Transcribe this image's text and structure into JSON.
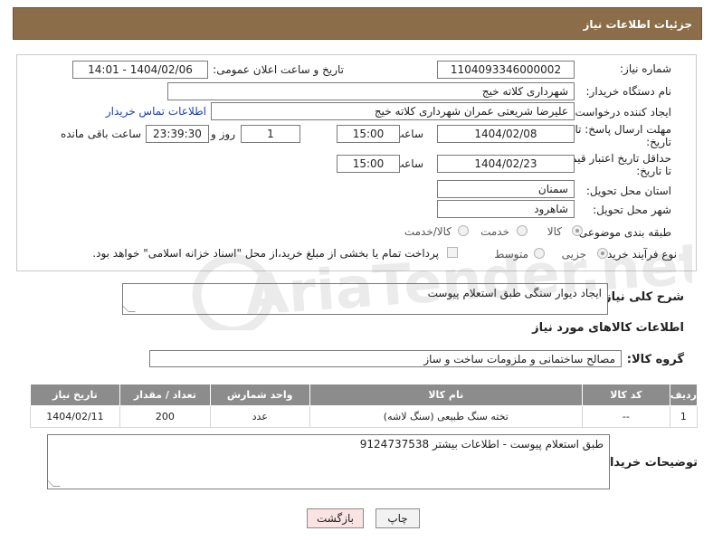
{
  "header": {
    "title": "جزئیات اطلاعات نیاز"
  },
  "form": {
    "need_number_label": "شماره نیاز:",
    "need_number": "1104093346000002",
    "announce_label": "تاریخ و ساعت اعلان عمومی:",
    "announce_value": "1404/02/06 - 14:01",
    "buyer_org_label": "نام دستگاه خریدار:",
    "buyer_org": "شهرداری کلاته خیج",
    "creator_label": "ایجاد کننده درخواست:",
    "creator": "علیرضا شریعتی عمران شهرداری کلاته خیج",
    "contact_link": "اطلاعات تماس خریدار",
    "deadline_label_1": "مهلت ارسال پاسخ: تا",
    "deadline_label_2": "تاریخ:",
    "deadline_date": "1404/02/08",
    "time_label": "ساعت",
    "deadline_time": "15:00",
    "days": "1",
    "days_label": "روز و",
    "remaining_time": "23:39:30",
    "remaining_label": "ساعت باقی مانده",
    "validity_label_1": "حداقل تاریخ اعتبار قیمت:",
    "validity_label_2": "تا تاریخ:",
    "validity_date": "1404/02/23",
    "validity_time": "15:00",
    "province_label": "استان محل تحویل:",
    "province": "سمنان",
    "city_label": "شهر محل تحویل:",
    "city": "شاهرود",
    "category_label": "طبقه بندی موضوعی:",
    "category_options": [
      "کالا",
      "خدمت",
      "کالا/خدمت"
    ],
    "purchase_type_label": "نوع فرآیند خرید :",
    "purchase_options": [
      "جزیی",
      "متوسط"
    ],
    "payment_note": "پرداخت تمام یا بخشی از مبلغ خرید،از محل \"اسناد خزانه اسلامی\" خواهد بود."
  },
  "description": {
    "label": "شرح کلی نیاز:",
    "value": "ایجاد دیوار سنگی طبق استعلام پیوست"
  },
  "goods_section": {
    "title": "اطلاعات کالاهای مورد نیاز",
    "group_label": "گروه کالا:",
    "group_value": "مصالح ساختمانی و ملزومات ساخت و ساز"
  },
  "table": {
    "headers": [
      "ردیف",
      "کد کالا",
      "نام کالا",
      "واحد شمارش",
      "تعداد / مقدار",
      "تاریخ نیاز"
    ],
    "rows": [
      [
        "1",
        "--",
        "تخته سنگ طبیعی (سنگ لاشه)",
        "عدد",
        "200",
        "1404/02/11"
      ]
    ]
  },
  "buyer_notes": {
    "label": "توضیحات خریدار:",
    "value": "طبق استعلام پیوست - اطلاعات بیشتر 9124737538"
  },
  "buttons": {
    "print": "چاپ",
    "back": "بازگشت"
  },
  "watermark": {
    "text": "AriaTender.net"
  },
  "colors": {
    "header_bg": "#8c6d4a",
    "table_header_bg": "#8c8c8c",
    "link": "#1a3fb8",
    "back_button_bg": "#fbe3e3"
  }
}
